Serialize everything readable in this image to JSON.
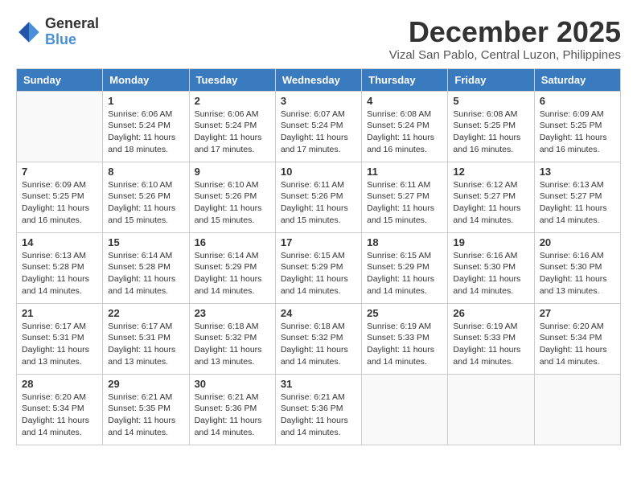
{
  "header": {
    "logo_general": "General",
    "logo_blue": "Blue",
    "month_title": "December 2025",
    "location": "Vizal San Pablo, Central Luzon, Philippines"
  },
  "weekdays": [
    "Sunday",
    "Monday",
    "Tuesday",
    "Wednesday",
    "Thursday",
    "Friday",
    "Saturday"
  ],
  "weeks": [
    [
      {
        "day": "",
        "info": ""
      },
      {
        "day": "1",
        "info": "Sunrise: 6:06 AM\nSunset: 5:24 PM\nDaylight: 11 hours\nand 18 minutes."
      },
      {
        "day": "2",
        "info": "Sunrise: 6:06 AM\nSunset: 5:24 PM\nDaylight: 11 hours\nand 17 minutes."
      },
      {
        "day": "3",
        "info": "Sunrise: 6:07 AM\nSunset: 5:24 PM\nDaylight: 11 hours\nand 17 minutes."
      },
      {
        "day": "4",
        "info": "Sunrise: 6:08 AM\nSunset: 5:24 PM\nDaylight: 11 hours\nand 16 minutes."
      },
      {
        "day": "5",
        "info": "Sunrise: 6:08 AM\nSunset: 5:25 PM\nDaylight: 11 hours\nand 16 minutes."
      },
      {
        "day": "6",
        "info": "Sunrise: 6:09 AM\nSunset: 5:25 PM\nDaylight: 11 hours\nand 16 minutes."
      }
    ],
    [
      {
        "day": "7",
        "info": "Sunrise: 6:09 AM\nSunset: 5:25 PM\nDaylight: 11 hours\nand 16 minutes."
      },
      {
        "day": "8",
        "info": "Sunrise: 6:10 AM\nSunset: 5:26 PM\nDaylight: 11 hours\nand 15 minutes."
      },
      {
        "day": "9",
        "info": "Sunrise: 6:10 AM\nSunset: 5:26 PM\nDaylight: 11 hours\nand 15 minutes."
      },
      {
        "day": "10",
        "info": "Sunrise: 6:11 AM\nSunset: 5:26 PM\nDaylight: 11 hours\nand 15 minutes."
      },
      {
        "day": "11",
        "info": "Sunrise: 6:11 AM\nSunset: 5:27 PM\nDaylight: 11 hours\nand 15 minutes."
      },
      {
        "day": "12",
        "info": "Sunrise: 6:12 AM\nSunset: 5:27 PM\nDaylight: 11 hours\nand 14 minutes."
      },
      {
        "day": "13",
        "info": "Sunrise: 6:13 AM\nSunset: 5:27 PM\nDaylight: 11 hours\nand 14 minutes."
      }
    ],
    [
      {
        "day": "14",
        "info": "Sunrise: 6:13 AM\nSunset: 5:28 PM\nDaylight: 11 hours\nand 14 minutes."
      },
      {
        "day": "15",
        "info": "Sunrise: 6:14 AM\nSunset: 5:28 PM\nDaylight: 11 hours\nand 14 minutes."
      },
      {
        "day": "16",
        "info": "Sunrise: 6:14 AM\nSunset: 5:29 PM\nDaylight: 11 hours\nand 14 minutes."
      },
      {
        "day": "17",
        "info": "Sunrise: 6:15 AM\nSunset: 5:29 PM\nDaylight: 11 hours\nand 14 minutes."
      },
      {
        "day": "18",
        "info": "Sunrise: 6:15 AM\nSunset: 5:29 PM\nDaylight: 11 hours\nand 14 minutes."
      },
      {
        "day": "19",
        "info": "Sunrise: 6:16 AM\nSunset: 5:30 PM\nDaylight: 11 hours\nand 14 minutes."
      },
      {
        "day": "20",
        "info": "Sunrise: 6:16 AM\nSunset: 5:30 PM\nDaylight: 11 hours\nand 13 minutes."
      }
    ],
    [
      {
        "day": "21",
        "info": "Sunrise: 6:17 AM\nSunset: 5:31 PM\nDaylight: 11 hours\nand 13 minutes."
      },
      {
        "day": "22",
        "info": "Sunrise: 6:17 AM\nSunset: 5:31 PM\nDaylight: 11 hours\nand 13 minutes."
      },
      {
        "day": "23",
        "info": "Sunrise: 6:18 AM\nSunset: 5:32 PM\nDaylight: 11 hours\nand 13 minutes."
      },
      {
        "day": "24",
        "info": "Sunrise: 6:18 AM\nSunset: 5:32 PM\nDaylight: 11 hours\nand 14 minutes."
      },
      {
        "day": "25",
        "info": "Sunrise: 6:19 AM\nSunset: 5:33 PM\nDaylight: 11 hours\nand 14 minutes."
      },
      {
        "day": "26",
        "info": "Sunrise: 6:19 AM\nSunset: 5:33 PM\nDaylight: 11 hours\nand 14 minutes."
      },
      {
        "day": "27",
        "info": "Sunrise: 6:20 AM\nSunset: 5:34 PM\nDaylight: 11 hours\nand 14 minutes."
      }
    ],
    [
      {
        "day": "28",
        "info": "Sunrise: 6:20 AM\nSunset: 5:34 PM\nDaylight: 11 hours\nand 14 minutes."
      },
      {
        "day": "29",
        "info": "Sunrise: 6:21 AM\nSunset: 5:35 PM\nDaylight: 11 hours\nand 14 minutes."
      },
      {
        "day": "30",
        "info": "Sunrise: 6:21 AM\nSunset: 5:36 PM\nDaylight: 11 hours\nand 14 minutes."
      },
      {
        "day": "31",
        "info": "Sunrise: 6:21 AM\nSunset: 5:36 PM\nDaylight: 11 hours\nand 14 minutes."
      },
      {
        "day": "",
        "info": ""
      },
      {
        "day": "",
        "info": ""
      },
      {
        "day": "",
        "info": ""
      }
    ]
  ]
}
